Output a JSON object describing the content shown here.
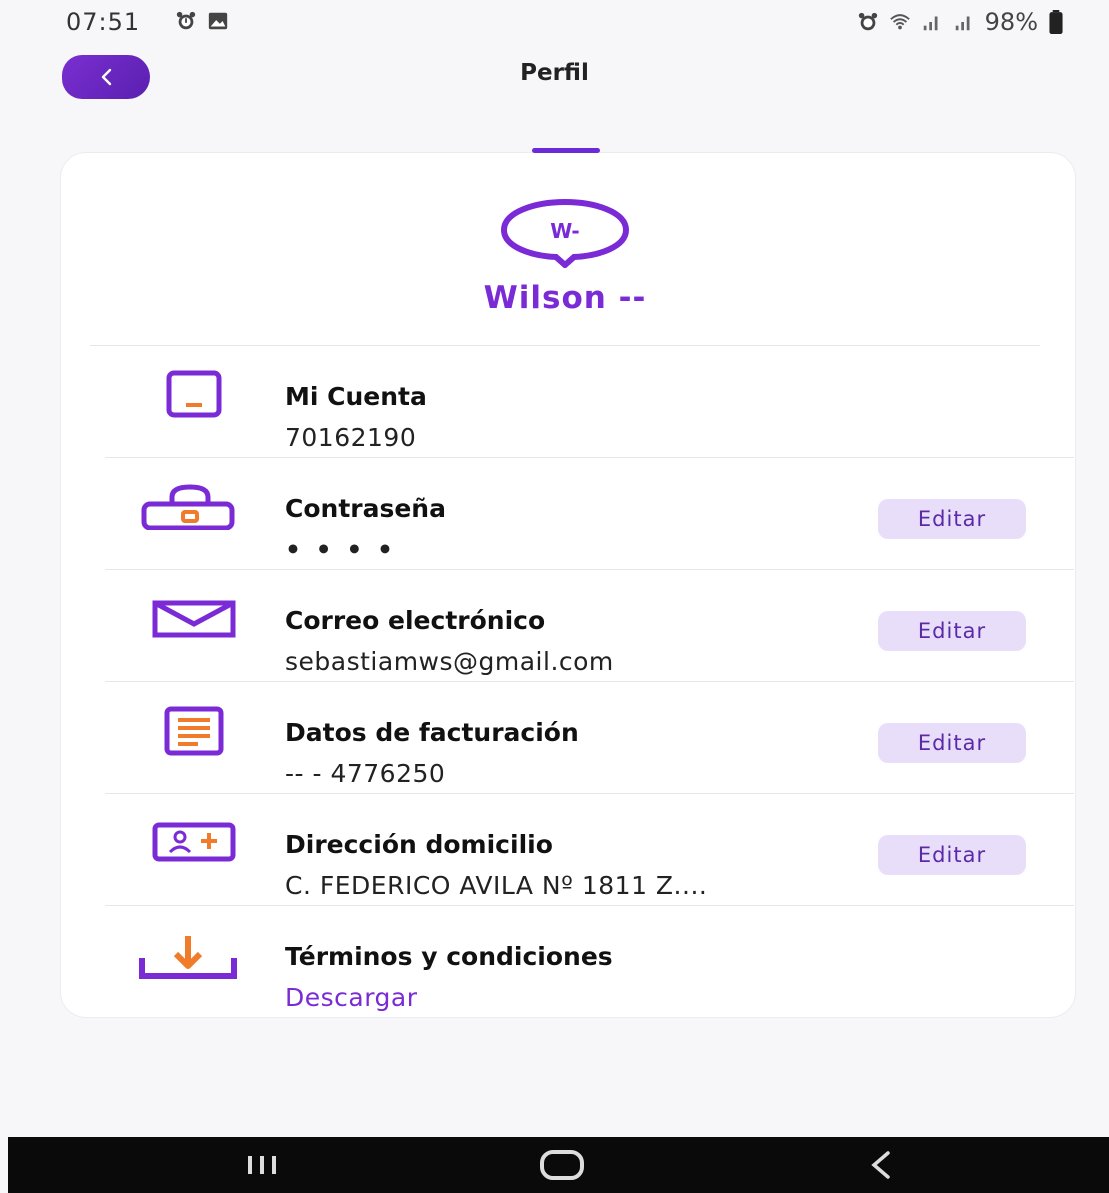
{
  "status_bar": {
    "time": "07:51",
    "battery": "98%"
  },
  "header": {
    "title": "Perfil"
  },
  "profile": {
    "avatar_initials": "W-",
    "name": "Wilson --"
  },
  "rows": [
    {
      "title": "Mi Cuenta",
      "value": "70162190",
      "icon": "phone-icon"
    },
    {
      "title": "Contraseña",
      "value": "• • • •",
      "icon": "lock-icon",
      "action": "Editar"
    },
    {
      "title": "Correo electrónico",
      "value": "sebastiamws@gmail.com",
      "icon": "mail-icon",
      "action": "Editar"
    },
    {
      "title": "Datos de facturación",
      "value": "-- - 4776250",
      "icon": "invoice-icon",
      "action": "Editar"
    },
    {
      "title": "Dirección domicilio",
      "value": "C. FEDERICO AVILA Nº 1811 Z....",
      "icon": "address-card-icon",
      "action": "Editar"
    },
    {
      "title": "Términos y condiciones",
      "link": "Descargar",
      "icon": "download-icon"
    }
  ],
  "colors": {
    "primary": "#7a2bd6",
    "accent": "#f07b2a",
    "edit_bg": "#e8def9"
  }
}
